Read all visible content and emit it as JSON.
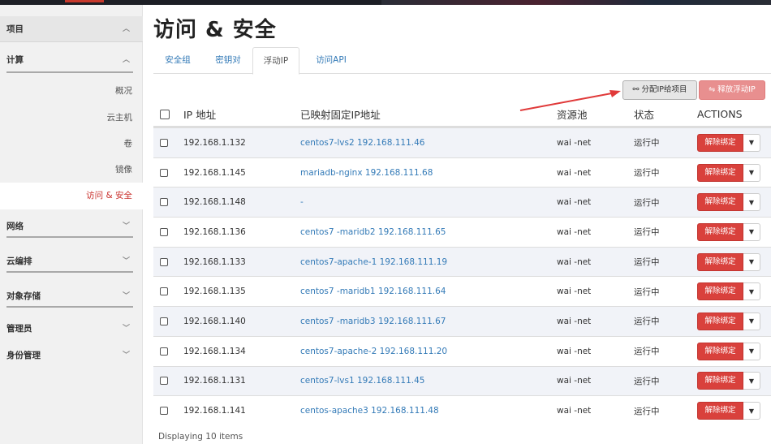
{
  "sidebar": {
    "project_label": "项目",
    "compute_label": "计算",
    "items": [
      {
        "label": "概况"
      },
      {
        "label": "云主机"
      },
      {
        "label": "卷"
      },
      {
        "label": "镜像"
      },
      {
        "label": "访问 & 安全"
      }
    ],
    "sections": [
      {
        "label": "网络"
      },
      {
        "label": "云编排"
      },
      {
        "label": "对象存储"
      },
      {
        "label": "管理员"
      },
      {
        "label": "身份管理"
      }
    ]
  },
  "page": {
    "title": "访问 & 安全"
  },
  "tabs": [
    {
      "label": "安全组"
    },
    {
      "label": "密钥对"
    },
    {
      "label": "浮动IP"
    },
    {
      "label": "访问API"
    }
  ],
  "actions": {
    "assign_label": "分配IP给项目",
    "release_label": "释放浮动IP"
  },
  "table": {
    "headers": {
      "ip": "IP 地址",
      "mapped": "已映射固定IP地址",
      "pool": "资源池",
      "state": "状态",
      "actions": "ACTIONS"
    },
    "rows": [
      {
        "ip": "192.168.1.132",
        "mapped": "centos7-lvs2 192.168.111.46",
        "pool": "wai -net",
        "state": "运行中",
        "action": "解除绑定"
      },
      {
        "ip": "192.168.1.145",
        "mapped": "mariadb-nginx 192.168.111.68",
        "pool": "wai -net",
        "state": "运行中",
        "action": "解除绑定"
      },
      {
        "ip": "192.168.1.148",
        "mapped": "-",
        "pool": "wai -net",
        "state": "运行中",
        "action": "解除绑定"
      },
      {
        "ip": "192.168.1.136",
        "mapped": "centos7 -maridb2 192.168.111.65",
        "pool": "wai -net",
        "state": "运行中",
        "action": "解除绑定"
      },
      {
        "ip": "192.168.1.133",
        "mapped": "centos7-apache-1 192.168.111.19",
        "pool": "wai -net",
        "state": "运行中",
        "action": "解除绑定"
      },
      {
        "ip": "192.168.1.135",
        "mapped": "centos7 -maridb1 192.168.111.64",
        "pool": "wai -net",
        "state": "运行中",
        "action": "解除绑定"
      },
      {
        "ip": "192.168.1.140",
        "mapped": "centos7 -maridb3 192.168.111.67",
        "pool": "wai -net",
        "state": "运行中",
        "action": "解除绑定"
      },
      {
        "ip": "192.168.1.134",
        "mapped": "centos7-apache-2 192.168.111.20",
        "pool": "wai -net",
        "state": "运行中",
        "action": "解除绑定"
      },
      {
        "ip": "192.168.1.131",
        "mapped": "centos7-lvs1 192.168.111.45",
        "pool": "wai -net",
        "state": "运行中",
        "action": "解除绑定"
      },
      {
        "ip": "192.168.1.141",
        "mapped": "centos-apache3 192.168.111.48",
        "pool": "wai -net",
        "state": "运行中",
        "action": "解除绑定"
      }
    ]
  },
  "footer": {
    "text": "Displaying 10 items"
  },
  "colors": {
    "danger": "#d9413c",
    "link": "#337ab7",
    "annotation_arrow": "#e03a3a"
  }
}
